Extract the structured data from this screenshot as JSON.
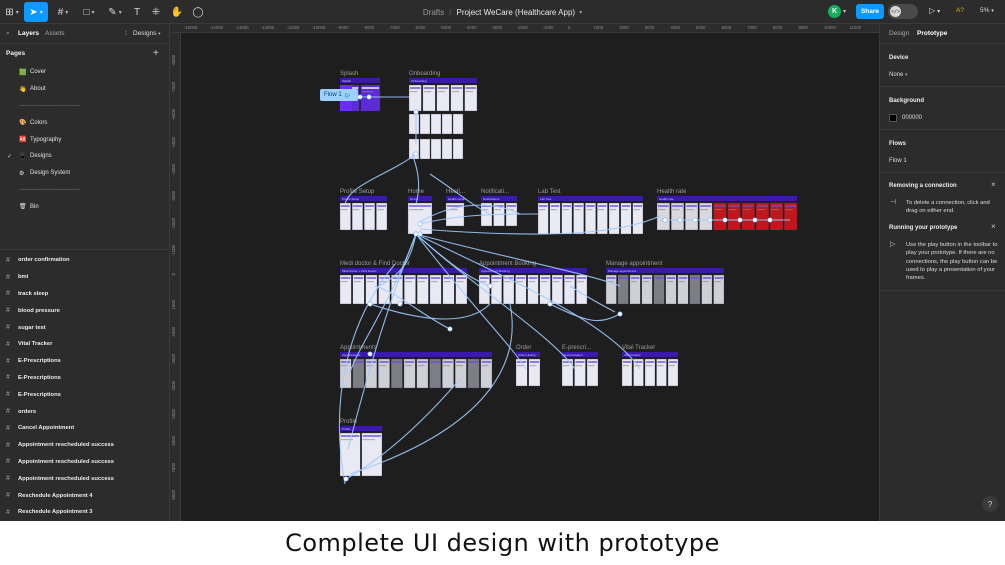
{
  "toolbar": {
    "menu_icon": "figma-menu-icon",
    "breadcrumb_parent": "Drafts",
    "file_name": "Project WeCare (Healthcare App)",
    "avatar_initial": "K",
    "share_label": "Share",
    "dev_mode_glyph": "</>",
    "aa_label": "A?",
    "zoom_label": "5%"
  },
  "left_panel": {
    "tab_layers": "Layers",
    "tab_assets": "Assets",
    "page_selector": "Designs",
    "pages_heading": "Pages",
    "pages": [
      {
        "icon": "🟩",
        "label": "Cover",
        "current": false
      },
      {
        "icon": "👋",
        "label": "About",
        "current": false
      },
      {
        "icon": "",
        "label": "------------------------------------",
        "current": false
      },
      {
        "icon": "🎨",
        "label": "Colors",
        "current": false
      },
      {
        "icon": "🆎",
        "label": "Typography",
        "current": false
      },
      {
        "icon": "📱",
        "label": "Designs",
        "current": true
      },
      {
        "icon": "⚙",
        "label": "Design System",
        "current": false
      },
      {
        "icon": "",
        "label": "------------------------------------",
        "current": false
      },
      {
        "icon": "🗑",
        "label": "Bin",
        "current": false
      }
    ],
    "layers": [
      "order confirmation",
      "bmi",
      "track sleep",
      "blood pressure",
      "sugar test",
      "Vital Tracker",
      "E-Prescriptions",
      "E-Prescriptions",
      "E-Prescriptions",
      "orders",
      "Cancel Appointment",
      "Appointment rescheduled success",
      "Appointment rescheduled success",
      "Appointment rescheduled success",
      "Reschedule Appointment 4",
      "Reschedule Appointment 3"
    ]
  },
  "canvas": {
    "ruler_top": [
      "-16000",
      "-14000",
      "-13000",
      "-12000",
      "-11000",
      "-10000",
      "-9000",
      "-8000",
      "-7000",
      "-6000",
      "-5000",
      "-4000",
      "-3000",
      "-2000",
      "-1000",
      "0",
      "1000",
      "2000",
      "3000",
      "4000",
      "5000",
      "6000",
      "7000",
      "8000",
      "9000",
      "10000",
      "11000"
    ],
    "ruler_left": [
      "-8000",
      "-7000",
      "-6000",
      "-5000",
      "-4000",
      "-3000",
      "-2000",
      "-1000",
      "0",
      "1000",
      "2000",
      "3000",
      "4000",
      "5000",
      "6000",
      "7000",
      "8000"
    ],
    "flow_badge": "Flow 1",
    "sections": [
      {
        "label": "Splash",
        "header": "Splash"
      },
      {
        "label": "Onboarding",
        "header": "Onboarding"
      },
      {
        "label": "Profile Setup",
        "header": "Profile Setup"
      },
      {
        "label": "Home",
        "header": "Home"
      },
      {
        "label": "Healt...",
        "header": "Health report"
      },
      {
        "label": "Notificati...",
        "header": "Notifications"
      },
      {
        "label": "Lab Test",
        "header": "Lab Test"
      },
      {
        "label": "Health rate",
        "header": "Health rate"
      },
      {
        "label": "Medi doctor & Find Doctor",
        "header": "Medi doctor + Find Doctor"
      },
      {
        "label": "Appointment Booking",
        "header": "Appointment Booking"
      },
      {
        "label": "Manage appointment",
        "header": "Manage appointment"
      },
      {
        "label": "Appointments",
        "header": "Appointments"
      },
      {
        "label": "Order",
        "header": "Order History"
      },
      {
        "label": "E-prescri...",
        "header": "E-prescription"
      },
      {
        "label": "Vital Tracker",
        "header": "Vital Tracker"
      },
      {
        "label": "Profile",
        "header": "Profile"
      }
    ]
  },
  "right_panel": {
    "tab_design": "Design",
    "tab_prototype": "Prototype",
    "device_title": "Device",
    "device_value": "None",
    "background_title": "Background",
    "background_hex": "000000",
    "flows_title": "Flows",
    "flow_item": "Flow 1",
    "removing_title": "Removing a connection",
    "removing_text": "To delete a connection, click and drag on either end.",
    "running_title": "Running your prototype",
    "running_text": "Use the play button in the toolbar to play your prototype. If there are no connections, the play button can be used to play a presentation of your frames.",
    "help": "?"
  },
  "caption": "Complete UI design with prototype",
  "colors": {
    "accent": "#0d99ff",
    "section_header": "#3b1aa8",
    "connector": "#9ccbff",
    "canvas": "#1e1e1e",
    "panel": "#2c2c2c"
  }
}
